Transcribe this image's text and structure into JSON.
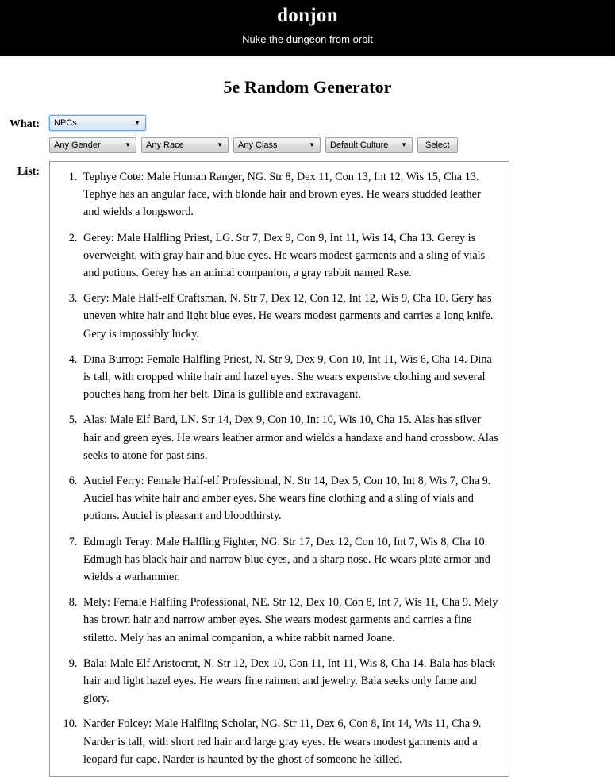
{
  "header": {
    "title": "donjon",
    "tagline": "Nuke the dungeon from orbit",
    "background_color": "#000000",
    "text_color": "#ffffff"
  },
  "page": {
    "title": "5e Random Generator"
  },
  "form": {
    "what_label": "What:",
    "list_label": "List:",
    "what_select": {
      "name": "what",
      "selected": "NPCs",
      "focused": true,
      "arrow_icon": "chevron-down-icon"
    },
    "filters": [
      {
        "name": "gender",
        "selected": "Any Gender",
        "arrow_icon": "chevron-down-icon"
      },
      {
        "name": "race",
        "selected": "Any Race",
        "arrow_icon": "chevron-down-icon"
      },
      {
        "name": "class",
        "selected": "Any Class",
        "arrow_icon": "chevron-down-icon"
      },
      {
        "name": "culture",
        "selected": "Default Culture",
        "arrow_icon": "chevron-down-icon"
      }
    ],
    "submit_label": "Select"
  },
  "results": {
    "count": 10,
    "items": [
      "Tephye Cote: Male Human Ranger, NG. Str 8, Dex 11, Con 13, Int 12, Wis 15, Cha 13. Tephye has an angular face, with blonde hair and brown eyes. He wears studded leather and wields a longsword.",
      "Gerey: Male Halfling Priest, LG. Str 7, Dex 9, Con 9, Int 11, Wis 14, Cha 13. Gerey is overweight, with gray hair and blue eyes. He wears modest garments and a sling of vials and potions. Gerey has an animal companion, a gray rabbit named Rase.",
      "Gery: Male Half-elf Craftsman, N. Str 7, Dex 12, Con 12, Int 12, Wis 9, Cha 10. Gery has uneven white hair and light blue eyes. He wears modest garments and carries a long knife. Gery is impossibly lucky.",
      "Dina Burrop: Female Halfling Priest, N. Str 9, Dex 9, Con 10, Int 11, Wis 6, Cha 14. Dina is tall, with cropped white hair and hazel eyes. She wears expensive clothing and several pouches hang from her belt. Dina is gullible and extravagant.",
      "Alas: Male Elf Bard, LN. Str 14, Dex 9, Con 10, Int 10, Wis 10, Cha 15. Alas has silver hair and green eyes. He wears leather armor and wields a handaxe and hand crossbow. Alas seeks to atone for past sins.",
      "Auciel Ferry: Female Half-elf Professional, N. Str 14, Dex 5, Con 10, Int 8, Wis 7, Cha 9. Auciel has white hair and amber eyes. She wears fine clothing and a sling of vials and potions. Auciel is pleasant and bloodthirsty.",
      "Edmugh Teray: Male Halfling Fighter, NG. Str 17, Dex 12, Con 10, Int 7, Wis 8, Cha 10. Edmugh has black hair and narrow blue eyes, and a sharp nose. He wears plate armor and wields a warhammer.",
      "Mely: Female Halfling Professional, NE. Str 12, Dex 10, Con 8, Int 7, Wis 11, Cha 9. Mely has brown hair and narrow amber eyes. She wears modest garments and carries a fine stiletto. Mely has an animal companion, a white rabbit named Joane.",
      "Bala: Male Elf Aristocrat, N. Str 12, Dex 10, Con 11, Int 11, Wis 8, Cha 14. Bala has black hair and light hazel eyes. He wears fine raiment and jewelry. Bala seeks only fame and glory.",
      "Narder Folcey: Male Halfling Scholar, NG. Str 11, Dex 6, Con 8, Int 14, Wis 11, Cha 9. Narder is tall, with short red hair and large gray eyes. He wears modest garments and a leopard fur cape. Narder is haunted by the ghost of someone he killed."
    ]
  }
}
